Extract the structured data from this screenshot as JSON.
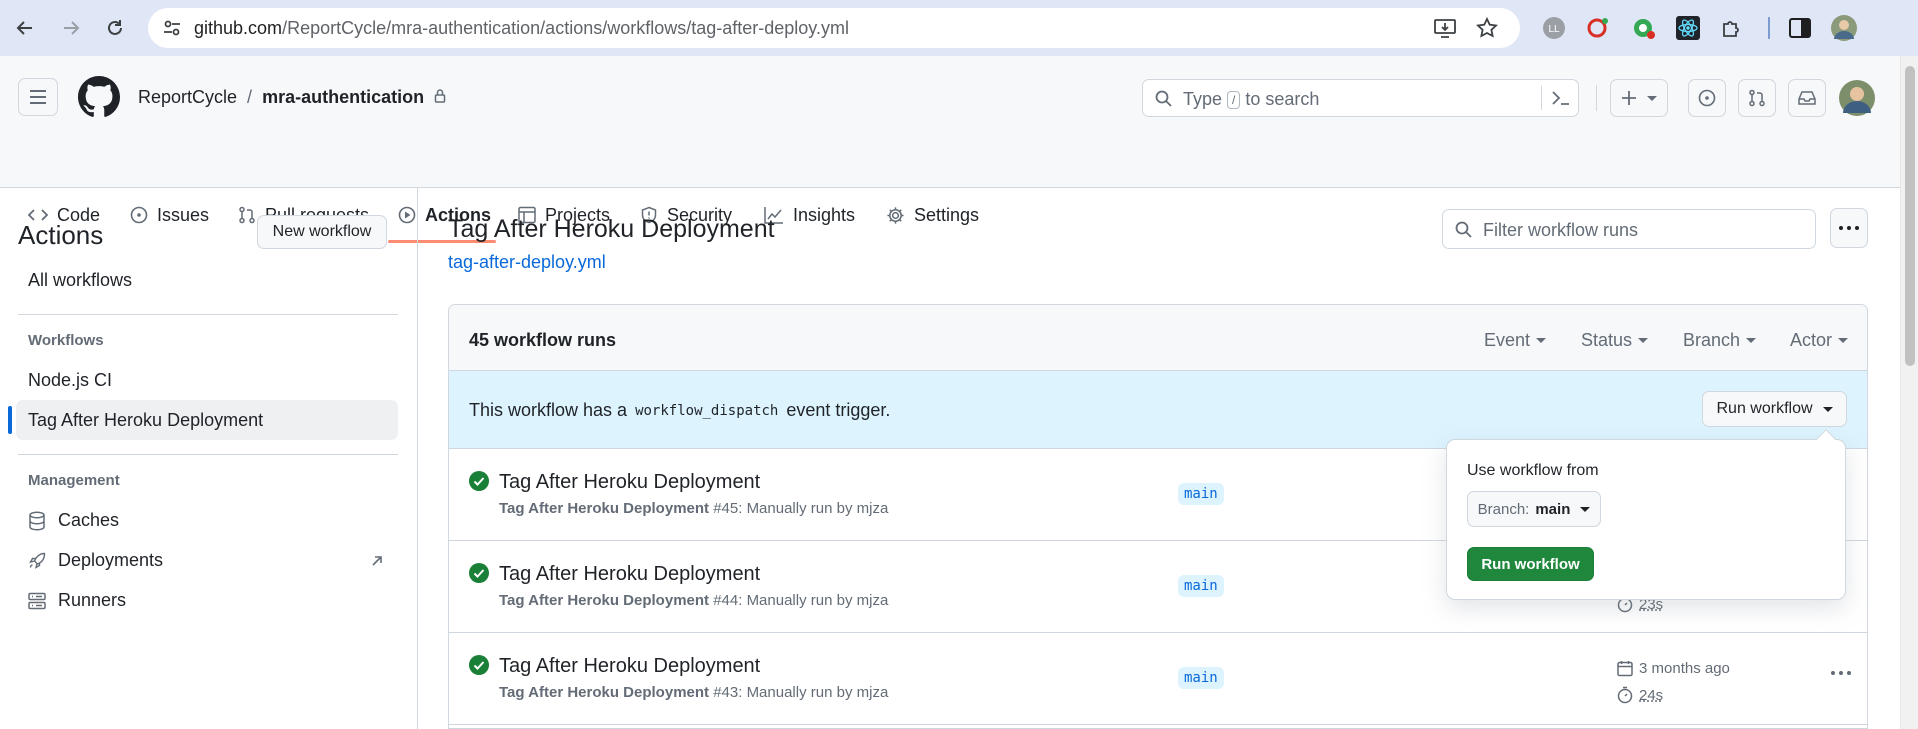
{
  "browser": {
    "url_host": "github.com",
    "url_path": "/ReportCycle/mra-authentication/actions/workflows/tag-after-deploy.yml"
  },
  "header": {
    "owner": "ReportCycle",
    "separator": "/",
    "repo": "mra-authentication",
    "search_prefix": "Type",
    "search_key": "/",
    "search_suffix": "to search"
  },
  "tabs": [
    {
      "label": "Code",
      "icon": "code-icon"
    },
    {
      "label": "Issues",
      "icon": "issue-icon"
    },
    {
      "label": "Pull requests",
      "icon": "pull-request-icon"
    },
    {
      "label": "Actions",
      "icon": "play-icon",
      "selected": true
    },
    {
      "label": "Projects",
      "icon": "table-icon"
    },
    {
      "label": "Security",
      "icon": "shield-icon"
    },
    {
      "label": "Insights",
      "icon": "graph-icon"
    },
    {
      "label": "Settings",
      "icon": "gear-icon"
    }
  ],
  "sidebar": {
    "title": "Actions",
    "new_workflow": "New workflow",
    "all_workflows": "All workflows",
    "workflows_heading": "Workflows",
    "workflows": [
      "Node.js CI",
      "Tag After Heroku Deployment"
    ],
    "management_heading": "Management",
    "management": [
      {
        "label": "Caches",
        "icon": "database-icon"
      },
      {
        "label": "Deployments",
        "icon": "rocket-icon"
      },
      {
        "label": "Runners",
        "icon": "server-icon"
      }
    ]
  },
  "main": {
    "title": "Tag After Heroku Deployment",
    "file_link": "tag-after-deploy.yml",
    "filter_placeholder": "Filter workflow runs",
    "runs_count": "45 workflow runs",
    "filters": [
      "Event",
      "Status",
      "Branch",
      "Actor"
    ],
    "dispatch_prefix": "This workflow has a",
    "dispatch_code": "workflow_dispatch",
    "dispatch_suffix": "event trigger.",
    "run_workflow_button": "Run workflow",
    "runs": [
      {
        "title": "Tag After Heroku Deployment",
        "name": "Tag After Heroku Deployment",
        "detail": "#45: Manually run by mjza",
        "branch": "main"
      },
      {
        "title": "Tag After Heroku Deployment",
        "name": "Tag After Heroku Deployment",
        "detail": "#44: Manually run by mjza",
        "branch": "main",
        "duration": "23s"
      },
      {
        "title": "Tag After Heroku Deployment",
        "name": "Tag After Heroku Deployment",
        "detail": "#43: Manually run by mjza",
        "branch": "main",
        "date": "3 months ago",
        "duration": "24s"
      }
    ]
  },
  "popover": {
    "heading": "Use workflow from",
    "branch_prefix": "Branch:",
    "branch_value": "main",
    "submit": "Run workflow"
  },
  "colors": {
    "accent": "#0969da",
    "success": "#1a7f37",
    "tab_underline": "#fd8c73",
    "dispatch_bg": "#ddf4ff"
  }
}
